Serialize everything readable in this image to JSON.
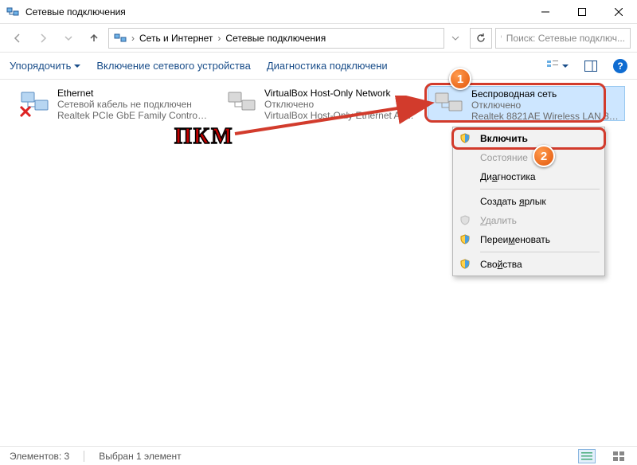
{
  "title": "Сетевые подключения",
  "breadcrumbs": {
    "root": "Сеть и Интернет",
    "current": "Сетевые подключения"
  },
  "search": {
    "placeholder": "Поиск: Сетевые подключ..."
  },
  "toolbar": {
    "organize": "Упорядочить",
    "enable": "Включение сетевого устройства",
    "diagnose": "Диагностика подключени"
  },
  "adapters": [
    {
      "name": "Ethernet",
      "status": "Сетевой кабель не подключен",
      "device": "Realtek PCIe GbE Family Controller",
      "unplugged": true
    },
    {
      "name": "VirtualBox Host-Only Network",
      "status": "Отключено",
      "device": "VirtualBox Host-Only Ethernet Ad..."
    },
    {
      "name": "Беспроводная сеть",
      "status": "Отключено",
      "device": "Realtek 8821AE Wireless LAN 802...",
      "selected": true
    }
  ],
  "context_menu": {
    "enable": "Включить",
    "status": "Состояние",
    "diagnose": "Диагностика",
    "shortcut": "Создать ярлык",
    "delete": "Удалить",
    "rename": "Переименовать",
    "properties": "Свойства"
  },
  "statusbar": {
    "count": "Элементов: 3",
    "selected": "Выбран 1 элемент"
  },
  "annotations": {
    "rmb": "ПКМ",
    "step1": "1",
    "step2": "2"
  }
}
